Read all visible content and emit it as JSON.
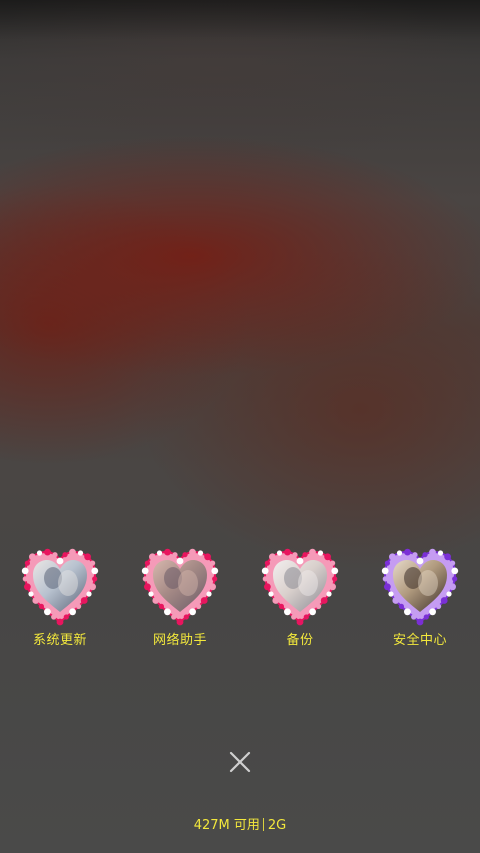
{
  "apps": [
    {
      "label": "系统更新",
      "icon": "heart-photo-icon",
      "border_colors": [
        "#e8155e",
        "#f59ab8",
        "#ffffff"
      ],
      "photo_colors": [
        "#b8c2cf",
        "#5b6478",
        "#e9e6e4"
      ]
    },
    {
      "label": "网络助手",
      "icon": "heart-photo-icon",
      "border_colors": [
        "#e8155e",
        "#f59ab8",
        "#ffffff"
      ],
      "photo_colors": [
        "#a58a86",
        "#6a5a66",
        "#d6b7ad"
      ]
    },
    {
      "label": "备份",
      "icon": "heart-photo-icon",
      "border_colors": [
        "#e8155e",
        "#f59ab8",
        "#ffffff"
      ],
      "photo_colors": [
        "#d9d0cc",
        "#8a8a94",
        "#f2eeee"
      ]
    },
    {
      "label": "安全中心",
      "icon": "heart-photo-icon",
      "border_colors": [
        "#7a2fd6",
        "#c59cf2",
        "#ffffff"
      ],
      "photo_colors": [
        "#b09a7e",
        "#3b2e28",
        "#e6d9c8"
      ]
    }
  ],
  "close": {
    "icon": "close-icon"
  },
  "status": {
    "memory": "427M 可用",
    "network": "2G"
  },
  "colors": {
    "label": "#f3e83c",
    "close": "#cfcfcf"
  }
}
